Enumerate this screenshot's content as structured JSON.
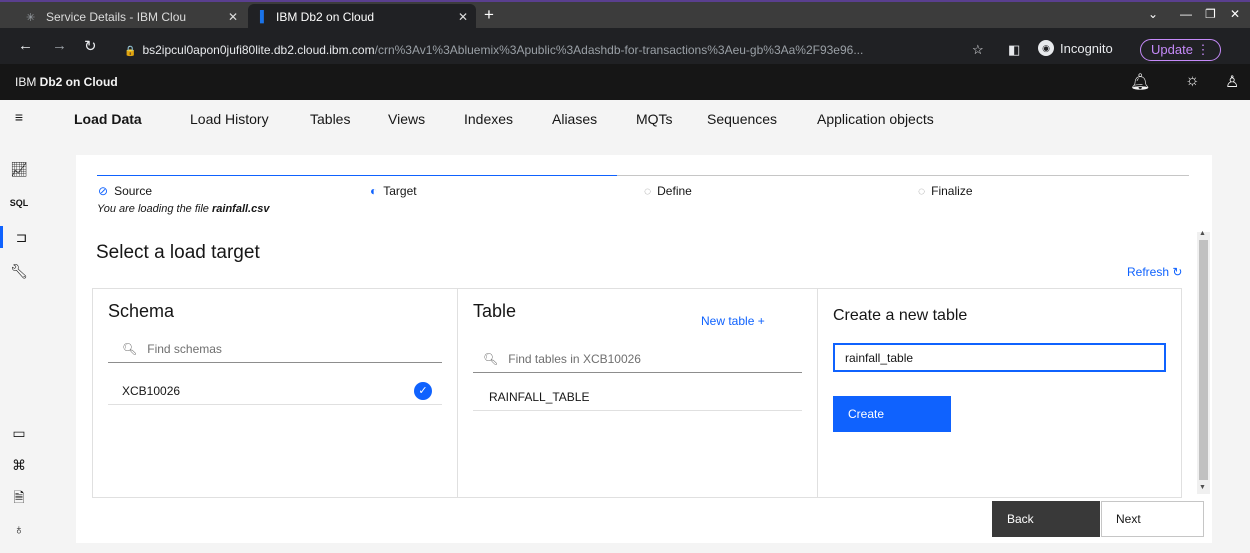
{
  "browser": {
    "tabs": [
      {
        "title": "Service Details - IBM Clou",
        "icon": "loading-spinner-icon"
      },
      {
        "title": "IBM Db2 on Cloud",
        "icon": "bar-chart-icon"
      }
    ],
    "url_host": "bs2ipcul0apon0jufi80lite.db2.cloud.ibm.com",
    "url_path": "/crn%3Av1%3Abluemix%3Apublic%3Adashdb-for-transactions%3Aeu-gb%3Aa%2F93e96...",
    "incognito_label": "Incognito",
    "update_label": "Update",
    "accent_color": "#c58af9"
  },
  "app": {
    "brand_prefix": "IBM ",
    "brand_bold": "Db2 on Cloud"
  },
  "nav_tabs": [
    {
      "label": "Load Data",
      "active": true
    },
    {
      "label": "Load History"
    },
    {
      "label": "Tables"
    },
    {
      "label": "Views"
    },
    {
      "label": "Indexes"
    },
    {
      "label": "Aliases"
    },
    {
      "label": "MQTs"
    },
    {
      "label": "Sequences"
    },
    {
      "label": "Application objects"
    }
  ],
  "rail": {
    "sql_label": "SQL"
  },
  "steps": [
    {
      "label": "Source",
      "state": "complete"
    },
    {
      "label": "Target",
      "state": "current"
    },
    {
      "label": "Define",
      "state": "incomplete"
    },
    {
      "label": "Finalize",
      "state": "incomplete"
    }
  ],
  "loading_note": {
    "prefix": "You are loading the file ",
    "file": "rainfall.csv"
  },
  "section_title": "Select a load target",
  "refresh_label": "Refresh",
  "schema": {
    "title": "Schema",
    "search_placeholder": "Find schemas",
    "items": [
      {
        "name": "XCB10026",
        "selected": true
      }
    ]
  },
  "table": {
    "title": "Table",
    "new_table_label": "New table",
    "search_placeholder": "Find tables in XCB10026",
    "items": [
      {
        "name": "RAINFALL_TABLE"
      }
    ]
  },
  "create": {
    "title": "Create a new table",
    "input_value": "rainfall_table",
    "button_label": "Create"
  },
  "footer": {
    "back_label": "Back",
    "next_label": "Next"
  },
  "colors": {
    "primary": "#0f62fe",
    "header_bg": "#161616",
    "back_bg": "#393939"
  }
}
